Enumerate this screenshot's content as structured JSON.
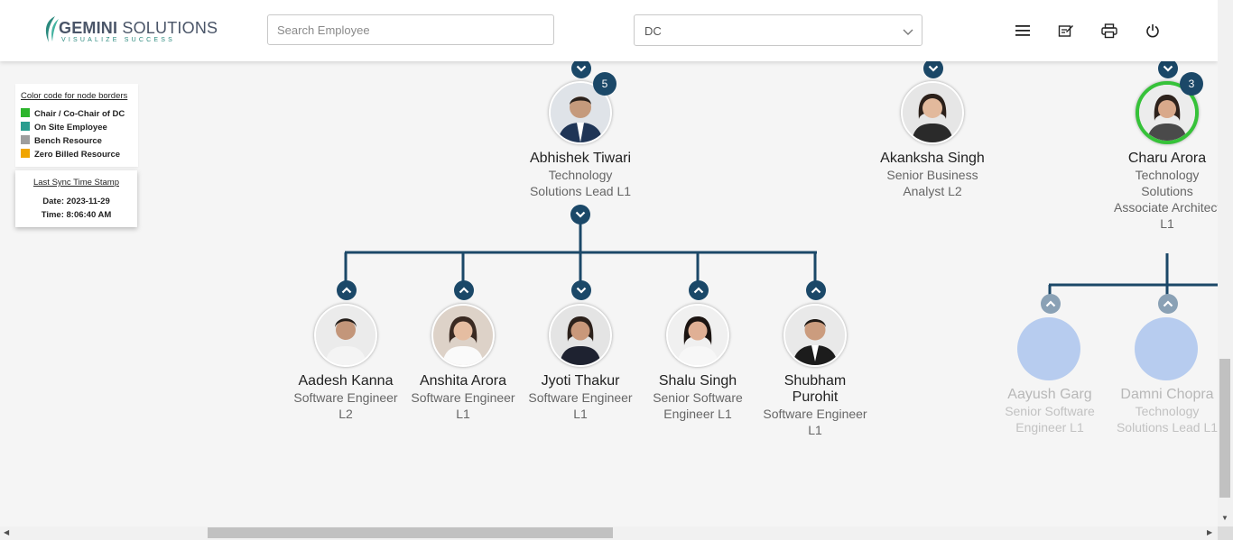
{
  "brand": {
    "name_bold": "GEMINI",
    "name_rest": " SOLUTIONS",
    "tagline": "VISUALIZE SUCCESS"
  },
  "search": {
    "placeholder": "Search Employee",
    "value": ""
  },
  "dc_select": {
    "value": "DC"
  },
  "header_icons": [
    "menu-icon",
    "edit-note-icon",
    "print-icon",
    "power-icon"
  ],
  "legend": {
    "title": "Color code for node borders",
    "items": [
      {
        "label": "Chair / Co-Chair of DC",
        "color": "#2db52d"
      },
      {
        "label": "On Site Employee",
        "color": "#2a9d8f"
      },
      {
        "label": "Bench Resource",
        "color": "#9e9e9e"
      },
      {
        "label": "Zero Billed Resource",
        "color": "#f0a500"
      }
    ]
  },
  "sync": {
    "title": "Last Sync Time Stamp",
    "date": "Date: 2023-11-29",
    "time": "Time: 8:06:40 AM"
  },
  "colors": {
    "connector": "#1b4868",
    "chair_border": "#36c239",
    "placeholder_avatar": "#b7ccef"
  },
  "top_nodes": [
    {
      "name": "Abhishek Tiwari",
      "title_lines": [
        "Technology",
        "Solutions Lead L1"
      ],
      "reports_count": "5"
    },
    {
      "name": "Akanksha Singh",
      "title_lines": [
        "Senior Business",
        "Analyst L2"
      ]
    },
    {
      "name": "Charu Arora",
      "title_lines": [
        "Technology",
        "Solutions",
        "Associate Architect",
        "L1"
      ],
      "reports_count": "3"
    }
  ],
  "children": [
    {
      "name": "Aadesh Kanna",
      "title_lines": [
        "Software Engineer",
        "L2"
      ]
    },
    {
      "name": "Anshita Arora",
      "title_lines": [
        "Software Engineer",
        "L1"
      ]
    },
    {
      "name": "Jyoti Thakur",
      "title_lines": [
        "Software Engineer",
        "L1"
      ]
    },
    {
      "name": "Shalu Singh",
      "title_lines": [
        "Senior Software",
        "Engineer L1"
      ]
    },
    {
      "name_lines": [
        "Shubham",
        "Purohit"
      ],
      "title_lines": [
        "Software Engineer",
        "L1"
      ]
    }
  ],
  "charu_children": [
    {
      "name": "Aayush Garg",
      "title_lines": [
        "Senior Software",
        "Engineer L1"
      ]
    },
    {
      "name": "Damni Chopra",
      "title_lines": [
        "Technology",
        "Solutions Lead L1"
      ]
    }
  ]
}
